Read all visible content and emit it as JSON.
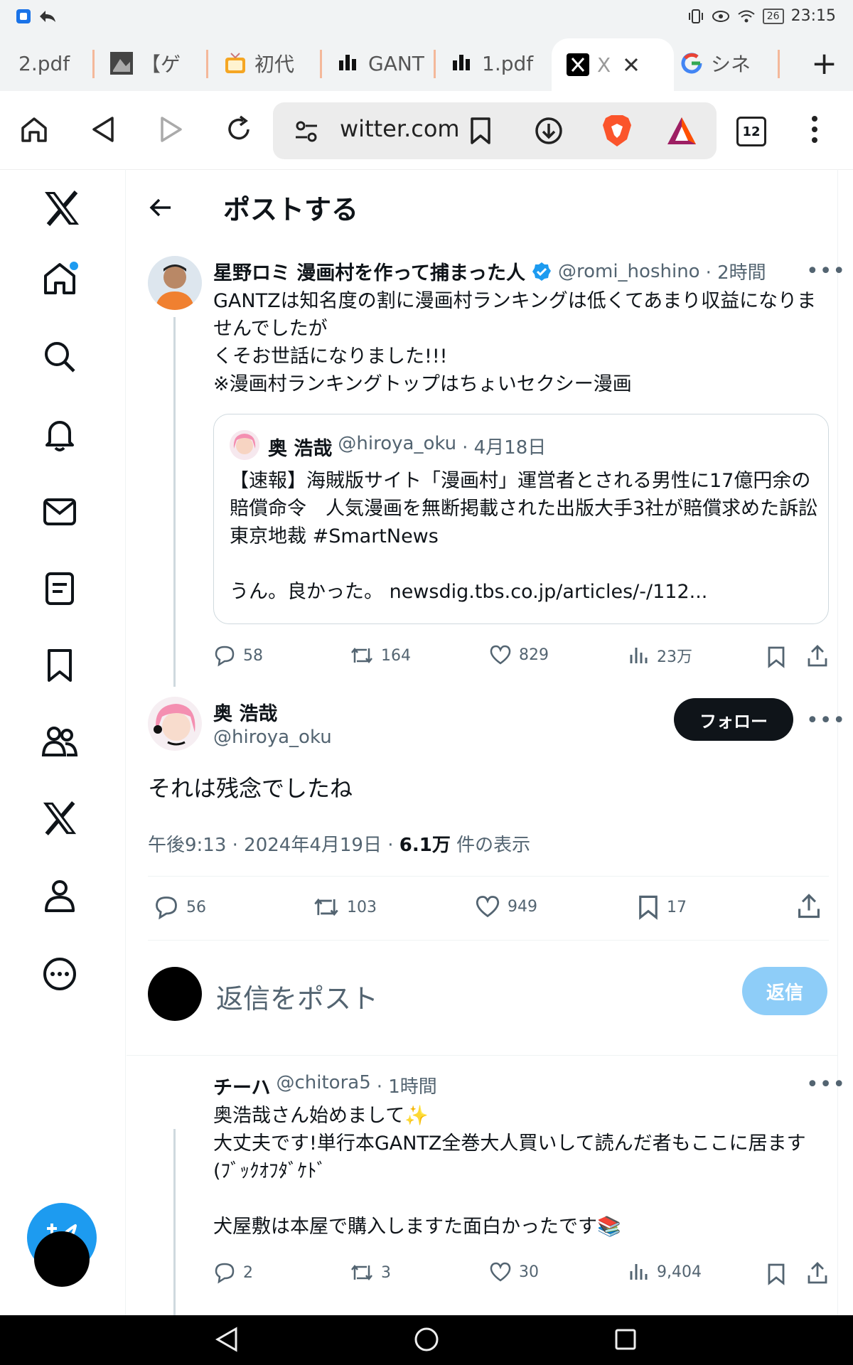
{
  "status_bar": {
    "time": "23:15",
    "battery": "26"
  },
  "tabs": [
    {
      "label": "2.pdf",
      "icon": "pdf-icon"
    },
    {
      "label": "【ゲ",
      "icon": "image-icon"
    },
    {
      "label": "初代",
      "icon": "tv-icon"
    },
    {
      "label": "GANT",
      "icon": "bars-icon"
    },
    {
      "label": "1.pdf",
      "icon": "bars-icon"
    },
    {
      "label": "X",
      "icon": "x-logo-icon"
    },
    {
      "label": "シネ",
      "icon": "google-icon"
    }
  ],
  "toolbar": {
    "url": "witter.com",
    "tab_count": "12"
  },
  "header": {
    "title": "ポストする"
  },
  "parent_post": {
    "name": "星野ロミ 漫画村を作って捕まった人",
    "handle": "@romi_hoshino",
    "time": "· 2時間",
    "text": "GANTZは知名度の割に漫画村ランキングは低くてあまり収益になりませんでしたが\nくそお世話になりました!!!\n※漫画村ランキングトップはちょいセクシー漫画",
    "quote": {
      "name": "奥 浩哉",
      "handle": "@hiroya_oku",
      "time": "· 4月18日",
      "text": "【速報】海賊版サイト「漫画村」運営者とされる男性に17億円余の賠償命令　人気漫画を無断掲載された出版大手3社が賠償求めた訴訟　東京地裁 #SmartNews\n\nうん。良かった。 newsdig.tbs.co.jp/articles/-/112..."
    },
    "replies": "58",
    "reposts": "164",
    "likes": "829",
    "views": "23万"
  },
  "main_post": {
    "name": "奥 浩哉",
    "handle": "@hiroya_oku",
    "follow_label": "フォロー",
    "text": "それは残念でしたね",
    "meta_time": "午後9:13 · 2024年4月19日 · ",
    "views_count": "6.1万",
    "views_label": " 件の表示",
    "replies": "56",
    "reposts": "103",
    "likes": "949",
    "bookmarks": "17"
  },
  "reply_composer": {
    "placeholder": "返信をポスト",
    "button": "返信"
  },
  "reply_post": {
    "name": "チーハ",
    "handle": "@chitora5",
    "time": "· 1時間",
    "text": "奥浩哉さん始めまして✨\n大丈夫です!単行本GANTZ全巻大人買いして読んだ者もここに居ます(ﾌﾞｯｸｵﾌﾀﾞｹﾄﾞ\n\n犬屋敷は本屋で購入しますた面白かったです📚",
    "replies": "2",
    "reposts": "3",
    "likes": "30",
    "views": "9,404"
  },
  "colors": {
    "accent": "#1d9bf0",
    "verified": "#1d9bf0",
    "text": "#0f1419",
    "muted": "#536471"
  }
}
